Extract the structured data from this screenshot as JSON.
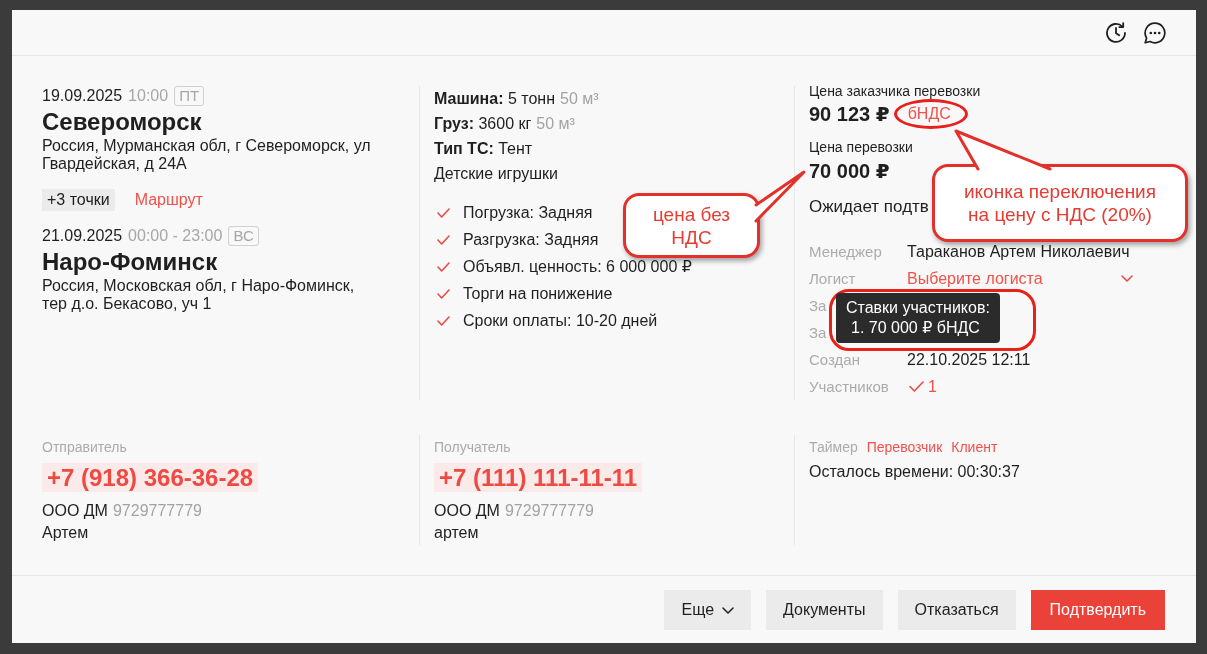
{
  "route": {
    "stops": [
      {
        "date": "19.09.2025",
        "time": "10:00",
        "weekday": "ПТ",
        "city": "Североморск",
        "address": "Россия, Мурманская обл, г Североморск, ул Гвардейская, д 24А"
      },
      {
        "date": "21.09.2025",
        "time": "00:00 - 23:00",
        "weekday": "ВС",
        "city": "Наро-Фоминск",
        "address": "Россия, Московская обл, г Наро-Фоминск, тер д.о. Бекасово, уч 1"
      }
    ],
    "more_points": "+3 точки",
    "route_link": "Маршрут"
  },
  "cargo": {
    "specs": [
      {
        "label": "Машина:",
        "value": "5 тонн",
        "volume": "50 м³"
      },
      {
        "label": "Груз:",
        "value": "3600 кг",
        "volume": "50 м³"
      },
      {
        "label": "Тип ТС:",
        "value": "Тент"
      }
    ],
    "description": "Детские игрушки",
    "conditions": [
      "Погрузка: Задняя",
      "Разгрузка: Задняя",
      "Объявл. ценность: 6 000 000 ₽",
      "Торги на понижение",
      "Сроки оплаты: 10-20 дней"
    ]
  },
  "pricing": {
    "customer_price": {
      "label": "Цена заказчика перевозки",
      "amount": "90 123 ₽",
      "vat_toggle": "бНДС"
    },
    "carrier_price": {
      "label": "Цена перевозки",
      "amount": "70 000 ₽"
    },
    "status": "Ожидает подтв"
  },
  "details": [
    {
      "kind": "text",
      "label": "Менеджер",
      "value": "Тараканов Артем Николаевич"
    },
    {
      "kind": "select",
      "label": "Логист",
      "value": "Выберите логиста"
    },
    {
      "kind": "text",
      "label": "За"
    },
    {
      "kind": "text",
      "label": "За"
    },
    {
      "kind": "text",
      "label": "Создан",
      "value": "22.10.2025 12:11"
    },
    {
      "kind": "count",
      "label": "Участников",
      "value": "1"
    }
  ],
  "bids_tooltip": {
    "title": "Ставки участников:",
    "lines": [
      "1. 70 000 ₽ бНДС"
    ]
  },
  "contacts": [
    {
      "label": "Отправитель",
      "phone": "+7 (918) 366-36-28",
      "company": "ООО ДМ",
      "inn": "9729777779",
      "person": "Артем"
    },
    {
      "label": "Получатель",
      "phone": "+7 (111) 111-11-11",
      "company": "ООО ДМ",
      "inn": "9729777779",
      "person": "артем"
    }
  ],
  "timer": {
    "label": "Таймер",
    "links": [
      "Перевозчик",
      "Клиент"
    ],
    "remaining": "Осталось времени: 00:30:37"
  },
  "actions": [
    {
      "kind": "menu",
      "label": "Еще"
    },
    {
      "kind": "default",
      "label": "Документы"
    },
    {
      "kind": "default",
      "label": "Отказаться"
    },
    {
      "kind": "primary",
      "label": "Подтвердить"
    }
  ],
  "annotations": [
    {
      "text": "цена без НДС"
    },
    {
      "text": "иконка переключения на цену с НДС (20%)"
    }
  ]
}
